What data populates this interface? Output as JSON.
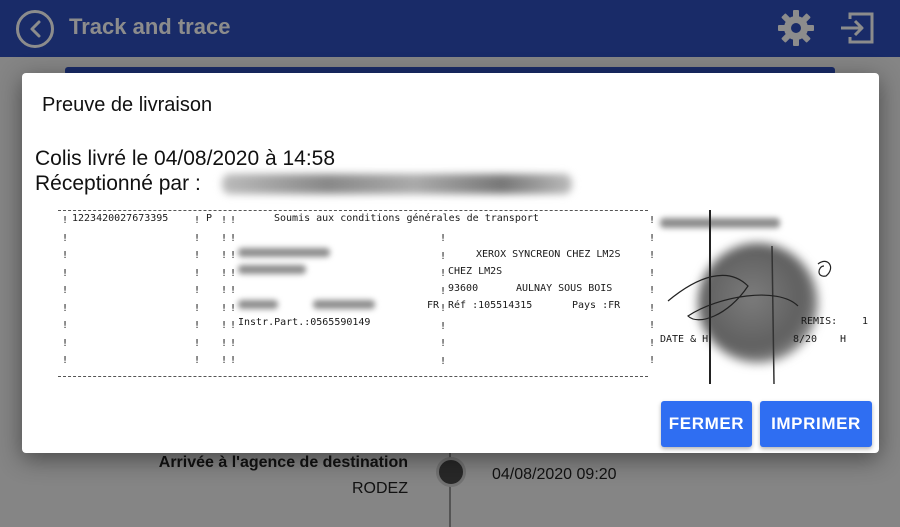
{
  "appbar": {
    "title": "Track and trace",
    "icons": {
      "back": "back-arrow-icon",
      "settings": "gear-icon",
      "logout": "exit-icon"
    }
  },
  "timeline": {
    "event_title": "Arrivée à l'agence de destination",
    "event_place": "RODEZ",
    "event_time": "04/08/2020 09:20"
  },
  "dialog": {
    "title": "Preuve de livraison",
    "delivered_line": "Colis livré le 04/08/2020 à 14:58",
    "received_by_label": "Réceptionné par :",
    "scan": {
      "tracking_number": "1223420027673395",
      "code": "P",
      "conditions": "Soumis aux conditions générales de transport",
      "recipient_name": "XEROX SYNCREON CHEZ LM2S",
      "recipient_c_o": "CHEZ LM2S",
      "recipient_zip": "93600",
      "recipient_city": "AULNAY SOUS BOIS",
      "sender_country_code": "FR",
      "reference": "Réf :105514315",
      "country": "Pays :FR",
      "instructions": "Instr.Part.:0565590149",
      "remis_label": "REMIS:",
      "remis_value": "1",
      "date_label": "DATE & H",
      "date_partial": "8/20",
      "hour_partial": "H"
    },
    "buttons": {
      "close": "FERMER",
      "print": "IMPRIMER"
    }
  },
  "colors": {
    "primary": "#2f4fbd",
    "button": "#2f6ef2",
    "scrim": "rgba(0,0,0,0.45)"
  }
}
